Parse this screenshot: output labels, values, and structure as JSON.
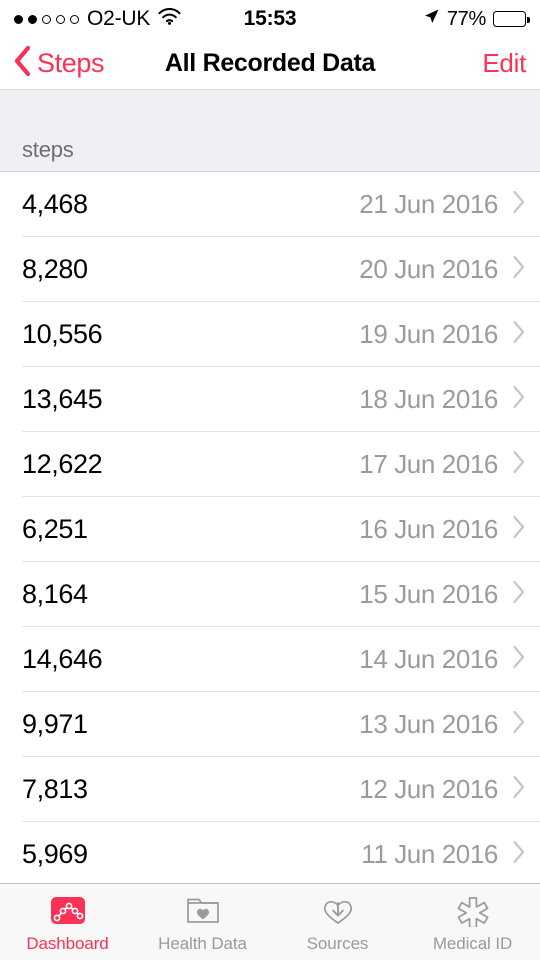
{
  "status_bar": {
    "signal_bars_filled": 2,
    "signal_bars_total": 5,
    "carrier": "O2-UK",
    "wifi_icon": "wifi-icon",
    "time": "15:53",
    "location_icon": "location-arrow-icon",
    "battery_percent": "77%",
    "battery_level": 77
  },
  "nav_bar": {
    "back_icon": "chevron-left-icon",
    "back_label": "Steps",
    "title": "All Recorded Data",
    "edit_label": "Edit",
    "accent_color": "#fc3158"
  },
  "list": {
    "section_header": "steps",
    "unit": "steps",
    "rows": [
      {
        "value": "4,468",
        "date": "21 Jun 2016"
      },
      {
        "value": "8,280",
        "date": "20 Jun 2016"
      },
      {
        "value": "10,556",
        "date": "19 Jun 2016"
      },
      {
        "value": "13,645",
        "date": "18 Jun 2016"
      },
      {
        "value": "12,622",
        "date": "17 Jun 2016"
      },
      {
        "value": "6,251",
        "date": "16 Jun 2016"
      },
      {
        "value": "8,164",
        "date": "15 Jun 2016"
      },
      {
        "value": "14,646",
        "date": "14 Jun 2016"
      },
      {
        "value": "9,971",
        "date": "13 Jun 2016"
      },
      {
        "value": "7,813",
        "date": "12 Jun 2016"
      },
      {
        "value": "5,969",
        "date": "11 Jun 2016"
      }
    ],
    "disclosure_icon": "chevron-right-icon"
  },
  "tab_bar": {
    "tabs": [
      {
        "label": "Dashboard",
        "icon": "dashboard-chart-icon",
        "active": true
      },
      {
        "label": "Health Data",
        "icon": "folder-heart-icon",
        "active": false
      },
      {
        "label": "Sources",
        "icon": "heart-download-icon",
        "active": false
      },
      {
        "label": "Medical ID",
        "icon": "medical-star-icon",
        "active": false
      }
    ],
    "active_color": "#fc3158",
    "inactive_color": "#9a9a9f"
  }
}
